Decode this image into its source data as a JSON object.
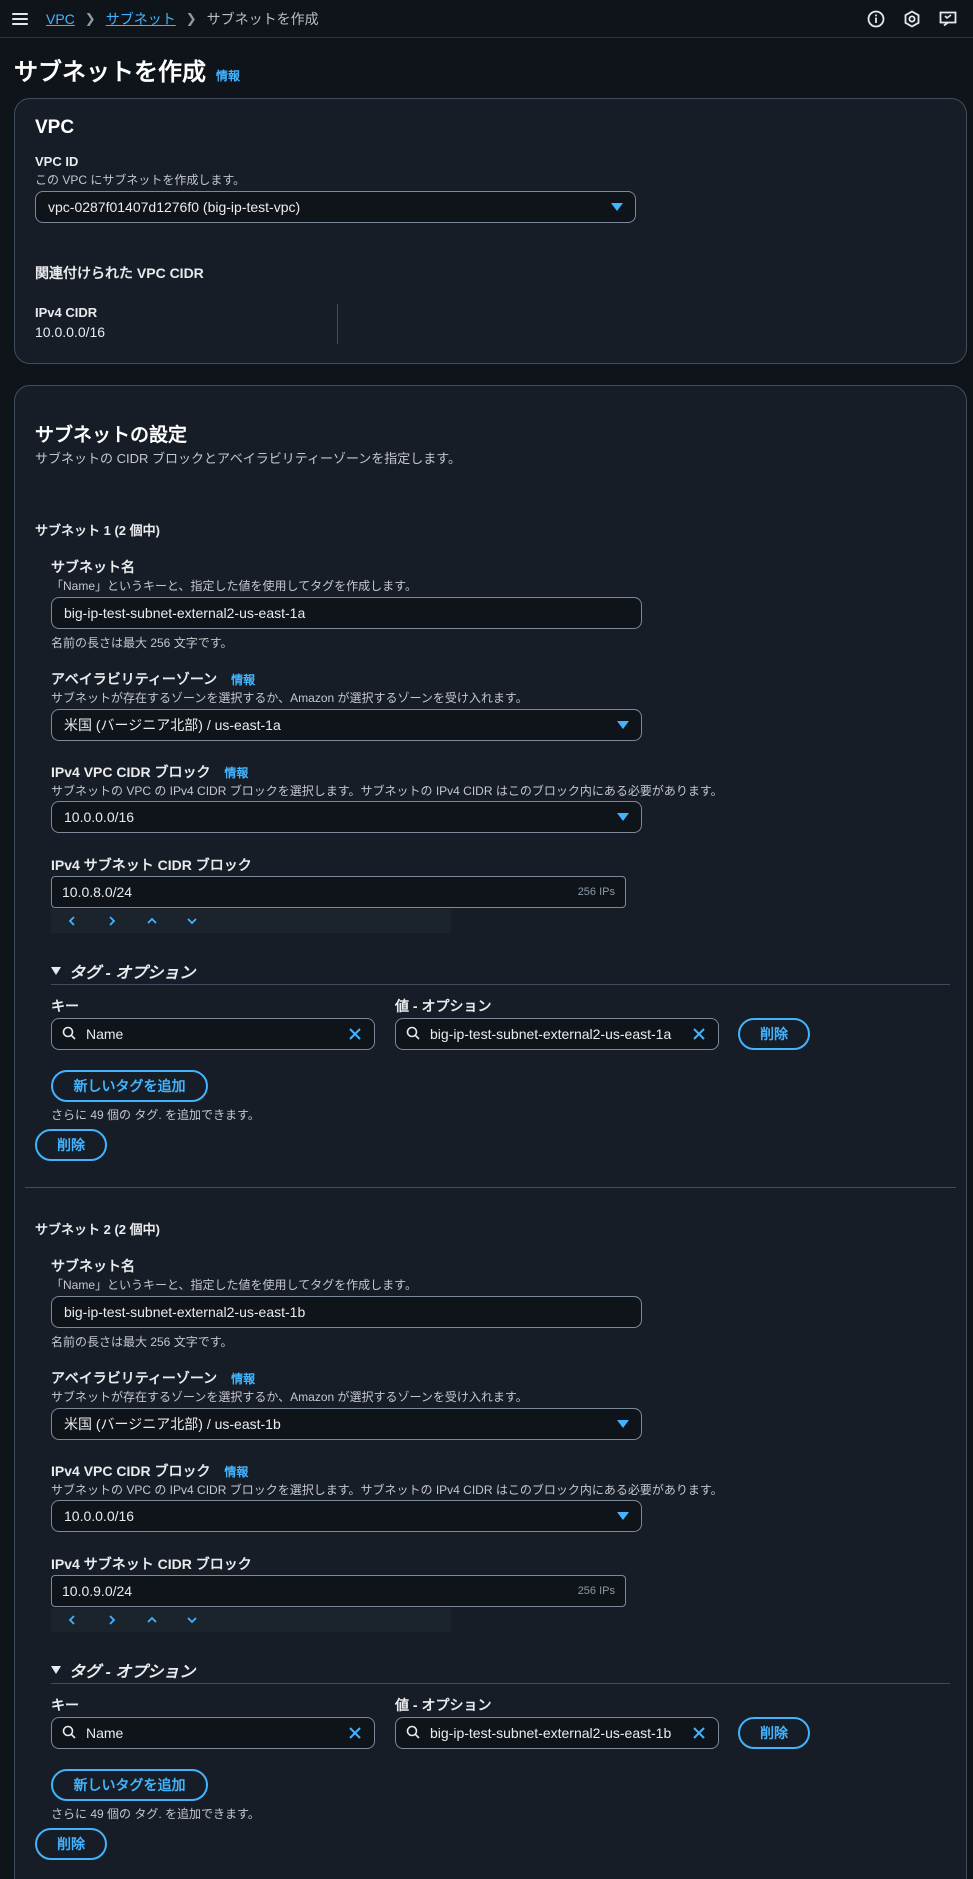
{
  "breadcrumb": {
    "vpc": "VPC",
    "subnet": "サブネット",
    "current": "サブネットを作成"
  },
  "page": {
    "title": "サブネットを作成",
    "info": "情報"
  },
  "vpc_section": {
    "heading": "VPC",
    "vpc_id_label": "VPC ID",
    "vpc_id_desc": "この VPC にサブネットを作成します。",
    "vpc_id_value": "vpc-0287f01407d1276f0 (big-ip-test-vpc)",
    "cidr_heading": "関連付けられた VPC CIDR",
    "ipv4_label": "IPv4 CIDR",
    "ipv4_value": "10.0.0.0/16"
  },
  "subnet_settings": {
    "heading": "サブネットの設定",
    "desc": "サブネットの CIDR ブロックとアベイラビリティーゾーンを指定します。",
    "subnets": [
      {
        "title": "サブネット 1 (2 個中)",
        "name_label": "サブネット名",
        "name_desc": "「Name」というキーと、指定した値を使用してタグを作成します。",
        "name_value": "big-ip-test-subnet-external2-us-east-1a",
        "name_hint": "名前の長さは最大 256 文字です。",
        "az_label": "アベイラビリティーゾーン",
        "az_info": "情報",
        "az_desc": "サブネットが存在するゾーンを選択するか、Amazon が選択するゾーンを受け入れます。",
        "az_value": "米国 (バージニア北部) / us-east-1a",
        "vpc_cidr_label": "IPv4 VPC CIDR ブロック",
        "vpc_cidr_info": "情報",
        "vpc_cidr_desc": "サブネットの VPC の IPv4 CIDR ブロックを選択します。サブネットの IPv4 CIDR はこのブロック内にある必要があります。",
        "vpc_cidr_value": "10.0.0.0/16",
        "subnet_cidr_label": "IPv4 サブネット CIDR ブロック",
        "subnet_cidr_value": "10.0.8.0/24",
        "subnet_cidr_ips": "256 IPs",
        "tags_toggle": "タグ - オプション",
        "key_label": "キー",
        "value_label": "値 - オプション",
        "tag_key": "Name",
        "tag_value": "big-ip-test-subnet-external2-us-east-1a",
        "tag_remove": "削除",
        "add_tag": "新しいタグを追加",
        "tag_hint": "さらに 49 個の タグ. を追加できます。",
        "remove": "削除"
      },
      {
        "title": "サブネット 2 (2 個中)",
        "name_label": "サブネット名",
        "name_desc": "「Name」というキーと、指定した値を使用してタグを作成します。",
        "name_value": "big-ip-test-subnet-external2-us-east-1b",
        "name_hint": "名前の長さは最大 256 文字です。",
        "az_label": "アベイラビリティーゾーン",
        "az_info": "情報",
        "az_desc": "サブネットが存在するゾーンを選択するか、Amazon が選択するゾーンを受け入れます。",
        "az_value": "米国 (バージニア北部) / us-east-1b",
        "vpc_cidr_label": "IPv4 VPC CIDR ブロック",
        "vpc_cidr_info": "情報",
        "vpc_cidr_desc": "サブネットの VPC の IPv4 CIDR ブロックを選択します。サブネットの IPv4 CIDR はこのブロック内にある必要があります。",
        "vpc_cidr_value": "10.0.0.0/16",
        "subnet_cidr_label": "IPv4 サブネット CIDR ブロック",
        "subnet_cidr_value": "10.0.9.0/24",
        "subnet_cidr_ips": "256 IPs",
        "tags_toggle": "タグ - オプション",
        "key_label": "キー",
        "value_label": "値 - オプション",
        "tag_key": "Name",
        "tag_value": "big-ip-test-subnet-external2-us-east-1b",
        "tag_remove": "削除",
        "add_tag": "新しいタグを追加",
        "tag_hint": "さらに 49 個の タグ. を追加できます。",
        "remove": "削除"
      }
    ]
  },
  "icons": [
    "menu-icon",
    "info-icon",
    "settings-icon",
    "feedback-icon",
    "caret-down-icon",
    "search-icon",
    "clear-icon",
    "chevron-left-icon",
    "chevron-right-icon",
    "chevron-up-icon",
    "chevron-down-icon"
  ],
  "colors": {
    "accent": "#42b4ff",
    "background": "#0f141a",
    "card": "#161d26",
    "border": "#414d5c"
  }
}
